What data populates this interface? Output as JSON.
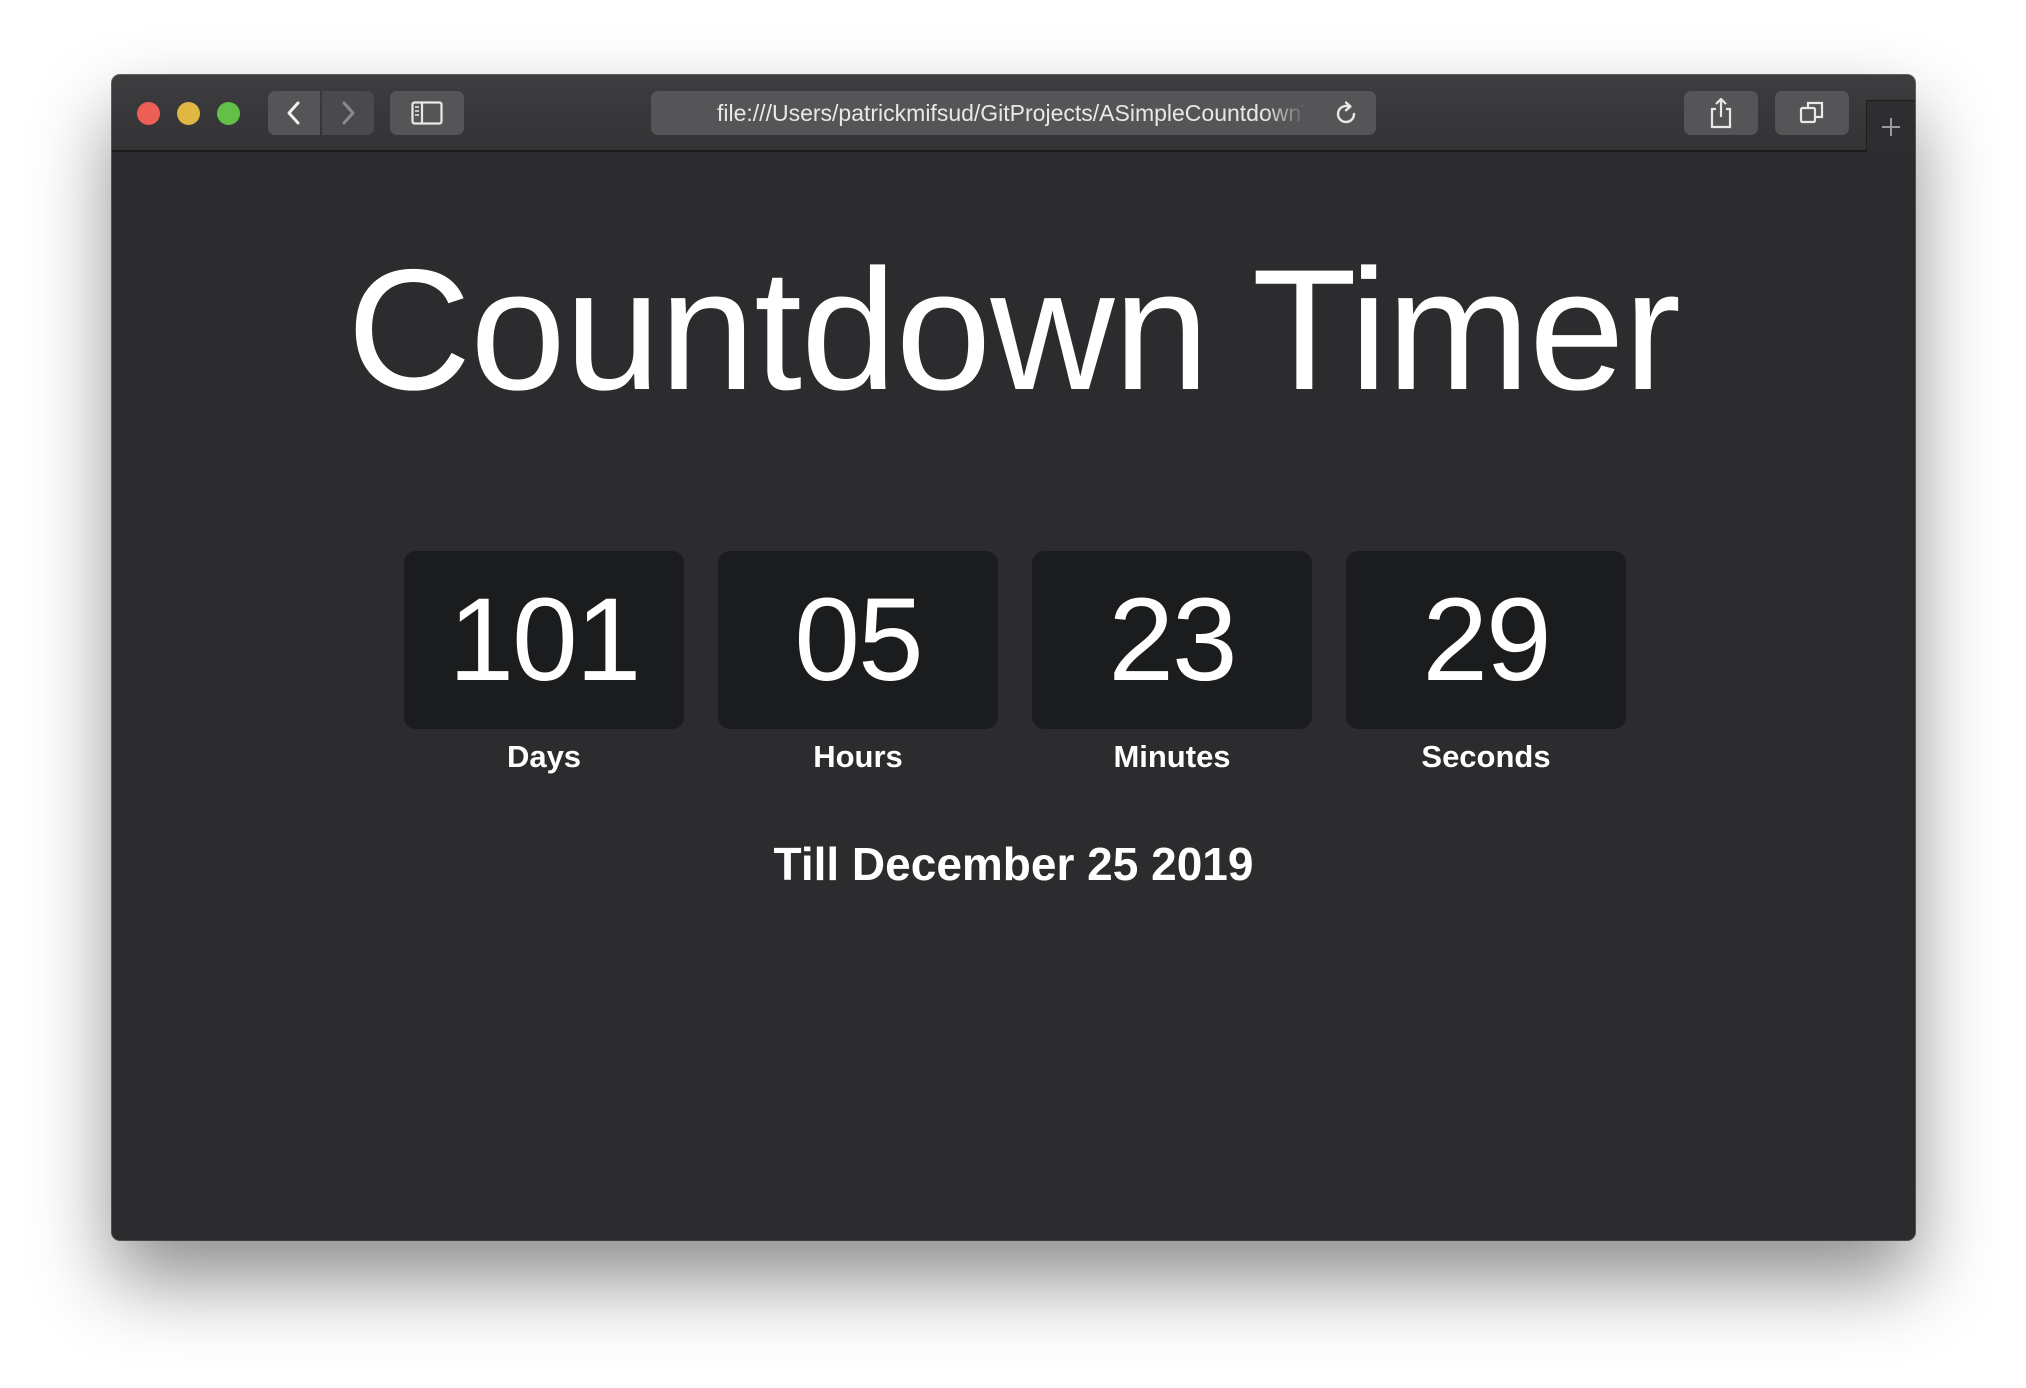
{
  "browser": {
    "address": "file:///Users/patrickmifsud/GitProjects/ASimpleCountdownTimer",
    "icons": {
      "back": "chevron-left-icon",
      "forward": "chevron-right-icon",
      "sidebar": "sidebar-icon",
      "reload": "reload-icon",
      "share": "share-icon",
      "tabs": "tab-overview-icon",
      "new_tab": "plus-icon"
    },
    "colors": {
      "close": "#ec5f57",
      "minimize": "#e0b742",
      "zoom": "#62bf47"
    }
  },
  "page": {
    "title": "Countdown Timer",
    "countdown": [
      {
        "value": "101",
        "label": "Days"
      },
      {
        "value": "05",
        "label": "Hours"
      },
      {
        "value": "23",
        "label": "Minutes"
      },
      {
        "value": "29",
        "label": "Seconds"
      }
    ],
    "target": "Till December 25 2019",
    "colors": {
      "background": "#2c2c2e",
      "tile": "#1b1c1e",
      "text": "#ffffff"
    }
  }
}
